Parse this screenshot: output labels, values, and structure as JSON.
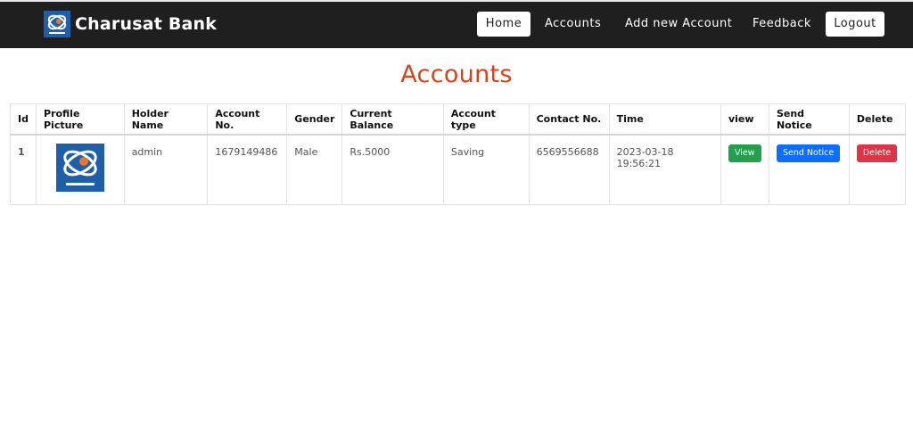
{
  "navbar": {
    "brand": "Charusat Bank",
    "home_label": "Home",
    "accounts_label": "Accounts",
    "add_account_label": "Add new Account",
    "feedback_label": "Feedback",
    "logout_label": "Logout"
  },
  "page_title": "Accounts",
  "table": {
    "headers": [
      "Id",
      "Profile Picture",
      "Holder Name",
      "Account No.",
      "Gender",
      "Current Balance",
      "Account type",
      "Contact No.",
      "Time",
      "view",
      "Send Notice",
      "Delete"
    ],
    "rows": [
      {
        "id": "1",
        "holder_name": "admin",
        "account_no": "1679149486",
        "gender": "Male",
        "balance": "Rs.5000",
        "account_type": "Saving",
        "contact": "6569556688",
        "time": "2023-03-18 19:56:21",
        "view_label": "View",
        "notice_label": "Send Notice",
        "delete_label": "Delete"
      }
    ]
  },
  "colors": {
    "navbar_bg": "#1f1f1f",
    "title": "#d4441d",
    "view_button": "#22a04b",
    "notice_button": "#0d6efd",
    "delete_button": "#dc3545",
    "logo_blue": "#1f5ea8"
  },
  "icons": [
    "charusat-logo-icon",
    "profile-picture-logo"
  ]
}
